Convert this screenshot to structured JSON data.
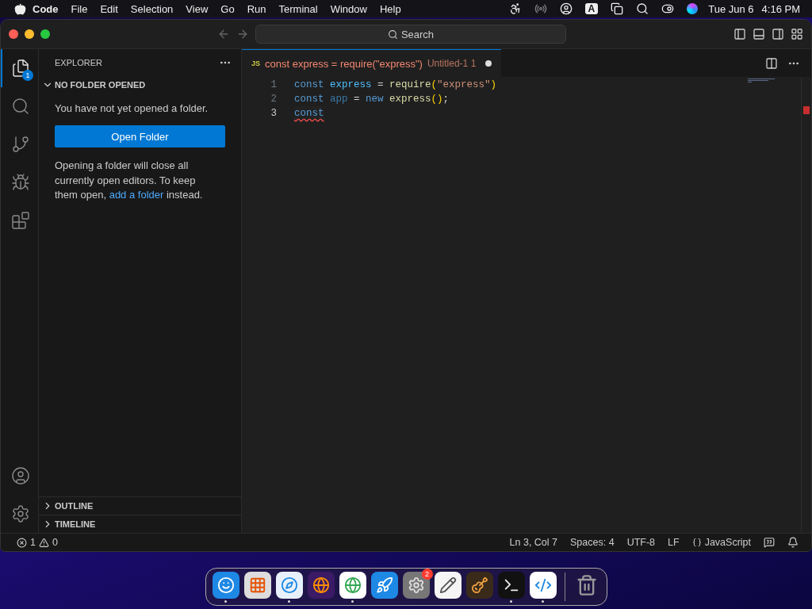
{
  "menu_bar": {
    "app": "Code",
    "menus": [
      "File",
      "Edit",
      "Selection",
      "View",
      "Go",
      "Run",
      "Terminal",
      "Window",
      "Help"
    ],
    "input_source": "A",
    "date": "Tue Jun 6",
    "time": "4:16 PM"
  },
  "title_bar": {
    "search": "Search"
  },
  "activity_bar": {
    "items": [
      {
        "kind": "explorer",
        "selected": true,
        "badge": "1"
      },
      {
        "kind": "search",
        "selected": false
      },
      {
        "kind": "source-control",
        "selected": false
      },
      {
        "kind": "run-debug",
        "selected": false
      },
      {
        "kind": "extensions",
        "selected": false
      }
    ],
    "bottom": [
      {
        "kind": "account"
      },
      {
        "kind": "settings"
      }
    ]
  },
  "sidebar": {
    "title": "EXPLORER",
    "section": {
      "title": "NO FOLDER OPENED",
      "expanded": true
    },
    "message": "You have not yet opened a folder.",
    "button": "Open Folder",
    "note_before": "Opening a folder will close all currently open editors. To keep them open, ",
    "note_link": "add a folder",
    "note_after": " instead.",
    "panels": [
      {
        "title": "OUTLINE",
        "expanded": false
      },
      {
        "title": "TIMELINE",
        "expanded": false
      }
    ]
  },
  "tabs": [
    {
      "icon_text": "JS",
      "title": "const express = require(\"express\")",
      "description": "Untitled-1",
      "problems": "1",
      "dirty": true,
      "selected": true
    }
  ],
  "editor": {
    "lines": [
      {
        "number": "1",
        "current": false,
        "squiggle": false,
        "tokens": [
          {
            "kind": "keyword",
            "text": "const"
          },
          {
            "kind": "variable",
            "text": " express"
          },
          {
            "kind": "operator",
            "text": " = "
          },
          {
            "kind": "function",
            "text": "require"
          },
          {
            "kind": "bracket",
            "text": "("
          },
          {
            "kind": "string",
            "text": "\"express\""
          },
          {
            "kind": "bracket",
            "text": ")"
          }
        ]
      },
      {
        "number": "2",
        "current": false,
        "squiggle": false,
        "tokens": [
          {
            "kind": "keyword",
            "text": "const"
          },
          {
            "kind": "unused",
            "text": " app"
          },
          {
            "kind": "operator",
            "text": " = "
          },
          {
            "kind": "keyword",
            "text": "new"
          },
          {
            "kind": "function",
            "text": " express"
          },
          {
            "kind": "bracket",
            "text": "()"
          },
          {
            "kind": "operator",
            "text": ";"
          }
        ]
      },
      {
        "number": "3",
        "current": true,
        "squiggle": true,
        "tokens": [
          {
            "kind": "keyword",
            "text": "const"
          }
        ]
      }
    ]
  },
  "status_bar": {
    "errors": "1",
    "warnings": "0",
    "items": [
      {
        "kind": "text",
        "text": "Ln 3, Col 7"
      },
      {
        "kind": "text",
        "text": "Spaces: 4"
      },
      {
        "kind": "text",
        "text": "UTF-8"
      },
      {
        "kind": "text",
        "text": "LF"
      },
      {
        "kind": "language",
        "text": "JavaScript"
      }
    ]
  },
  "dock": {
    "apps": [
      {
        "kind": "finder",
        "running": true
      },
      {
        "kind": "launchpad",
        "running": false
      },
      {
        "kind": "safari",
        "running": true
      },
      {
        "kind": "firefox",
        "running": false
      },
      {
        "kind": "chrome",
        "running": true
      },
      {
        "kind": "app-store",
        "running": false
      },
      {
        "kind": "settings",
        "running": false,
        "badge": "2"
      },
      {
        "kind": "textedit",
        "running": false
      },
      {
        "kind": "garageband",
        "running": false
      },
      {
        "kind": "terminal",
        "running": true
      },
      {
        "kind": "vscode",
        "running": true
      }
    ],
    "trash": {
      "running": false
    }
  }
}
